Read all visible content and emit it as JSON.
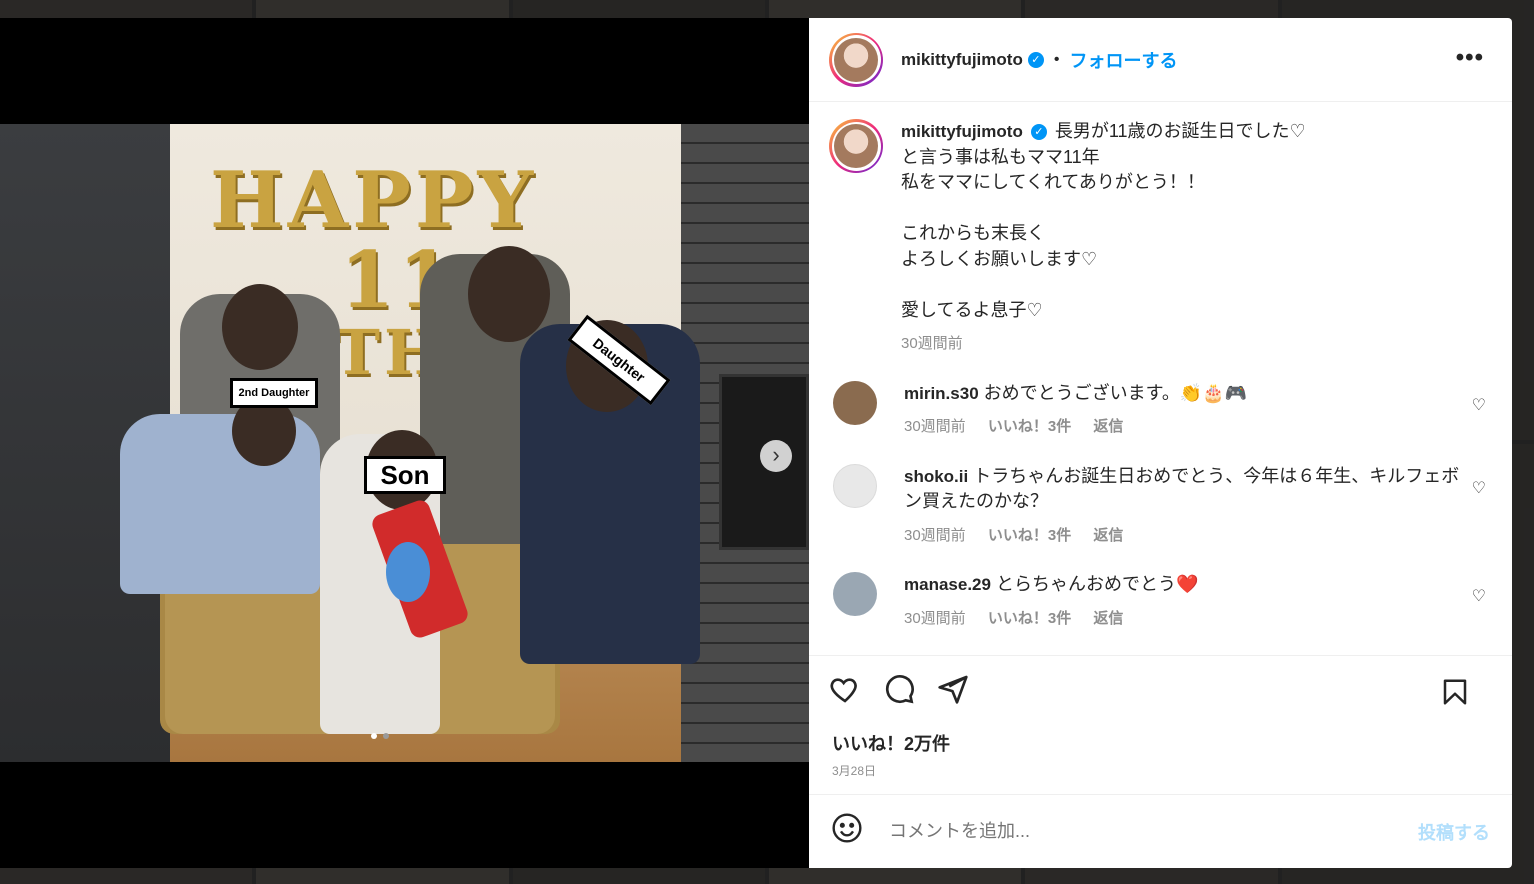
{
  "post": {
    "username": "mikittyfujimoto",
    "follow_label": "フォローする",
    "separator": "•",
    "more_label": "•••",
    "caption_lines": "長男が11歳のお誕生日でした♡\nと言う事は私もママ11年\n私をママにしてくれてありがとう！！\n\nこれからも末長く\nよろしくお願いします♡\n\n愛してるよ息子♡",
    "caption_time": "30週間前",
    "likes": "いいね！2万件",
    "date": "3月28日"
  },
  "photo": {
    "balloon_text": "HAPPY",
    "balloon_number": "11",
    "balloon_text2": "BIRTHDAY",
    "tag_2nd": "2nd Daughter",
    "tag_son": "Son",
    "tag_daughter": "Daughter",
    "next_label": "›"
  },
  "comments": [
    {
      "user": "mirin.s30",
      "text": "おめでとうございます。👏🎂🎮",
      "time": "30週間前",
      "likes": "いいね！3件",
      "reply": "返信",
      "avatar_color": "#8a6b4f"
    },
    {
      "user": "shoko.ii",
      "text": "トラちゃんお誕生日おめでとう、今年は６年生、キルフェボン買えたのかな？",
      "time": "30週間前",
      "likes": "いいね！3件",
      "reply": "返信",
      "avatar_color": "#e8e8e8"
    },
    {
      "user": "manase.29",
      "text": "とらちゃんおめでとう❤️",
      "time": "30週間前",
      "likes": "いいね！3件",
      "reply": "返信",
      "avatar_color": "#9aa7b3"
    }
  ],
  "add_comment": {
    "placeholder": "コメントを追加...",
    "post_label": "投稿する"
  },
  "icons": [
    "heart-icon",
    "comment-icon",
    "share-icon",
    "bookmark-icon",
    "emoji-icon",
    "verified-icon",
    "more-icon"
  ],
  "colors": {
    "accent": "#0095f6",
    "post_disabled": "#b2dffc",
    "heart_red": "#ed4956"
  }
}
